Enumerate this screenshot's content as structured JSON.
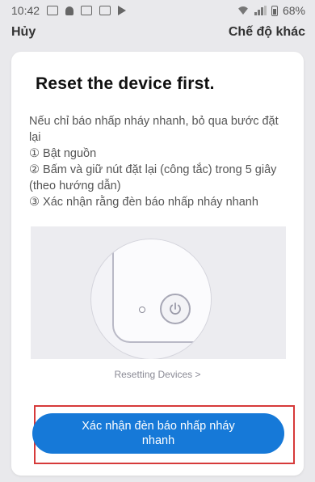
{
  "status_bar": {
    "time": "10:42",
    "battery_percent": "68%",
    "icons_left": [
      "gallery-icon",
      "notification-bell-icon",
      "image-icon",
      "image-icon",
      "play-icon"
    ],
    "icons_right": [
      "wifi-icon",
      "signal-icon",
      "battery-icon"
    ]
  },
  "nav": {
    "cancel_label": "Hủy",
    "other_mode_label": "Chế độ khác"
  },
  "card": {
    "title": "Reset the device first.",
    "instructions": [
      "Nếu chỉ báo nhấp nháy nhanh, bỏ qua bước đặt lại",
      "① Bật nguồn",
      "② Bấm và giữ nút đặt lại (công tắc) trong 5 giây (theo hướng dẫn)",
      "③ Xác nhận rằng đèn báo nhấp nháy nhanh"
    ],
    "illustration_icon": "power-icon",
    "resetting_link": "Resetting Devices  >",
    "confirm_button": "Xác nhận đèn báo nhấp nháy nhanh"
  },
  "colors": {
    "accent": "#1679d8",
    "highlight": "#d63a3a",
    "background": "#e9e9ec"
  }
}
